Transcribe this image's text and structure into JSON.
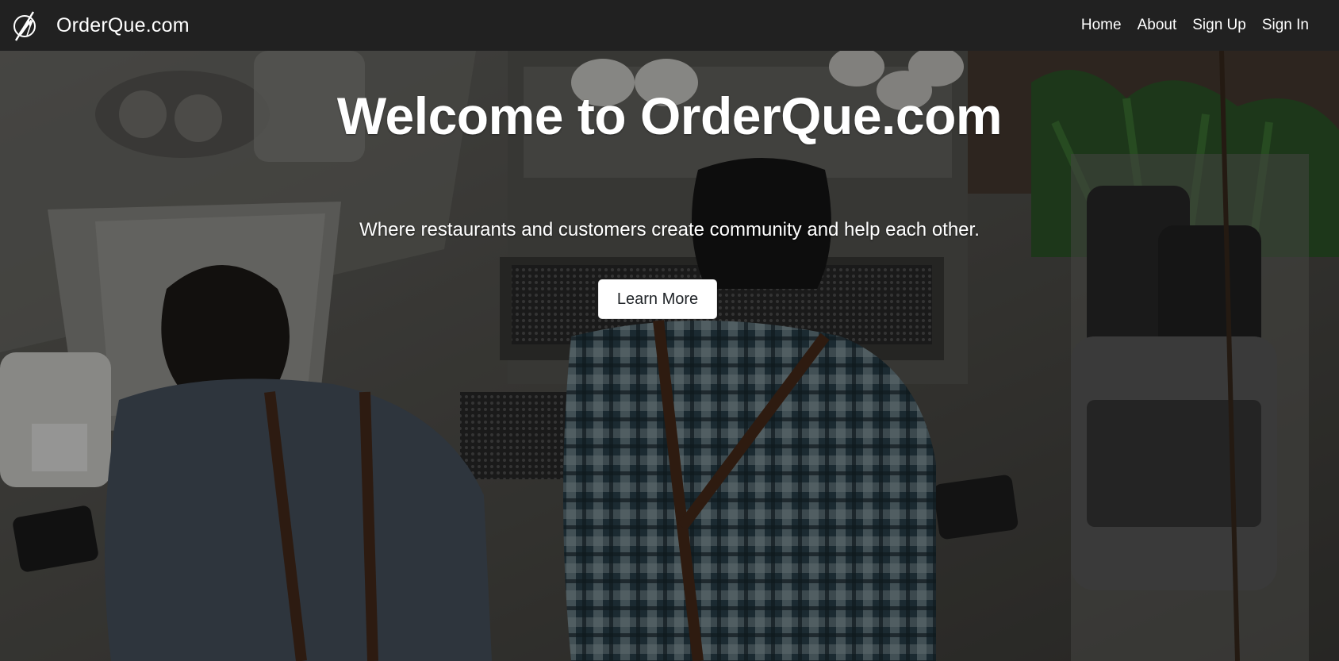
{
  "brand": {
    "name": "OrderQue.com",
    "logo_icon": "fork-knife-circle-icon"
  },
  "nav": {
    "items": [
      {
        "label": "Home"
      },
      {
        "label": "About"
      },
      {
        "label": "Sign Up"
      },
      {
        "label": "Sign In"
      }
    ]
  },
  "hero": {
    "title": "Welcome to OrderQue.com",
    "subtitle": "Where restaurants and customers create community and help each other.",
    "button_label": "Learn More",
    "background": "photo of two baristas at a marble coffee bar with espresso machine",
    "colors": {
      "navbar": "#212121",
      "button_bg": "#ffffff",
      "button_text": "#212529"
    }
  }
}
